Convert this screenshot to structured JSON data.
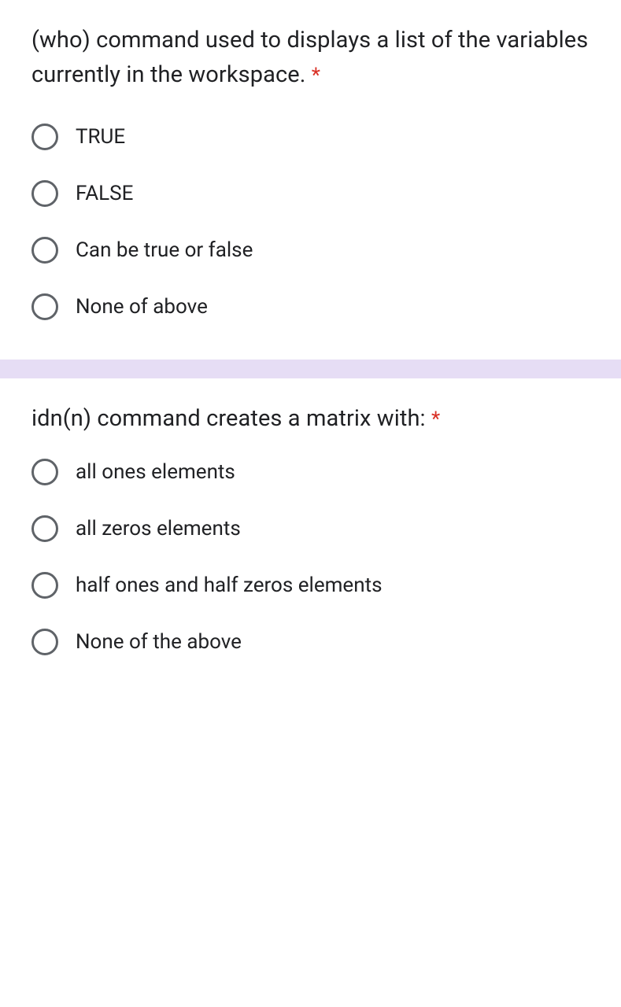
{
  "questions": [
    {
      "text": "(who) command used to displays a list of the variables currently in the workspace.",
      "required": "*",
      "options": [
        {
          "label": "TRUE"
        },
        {
          "label": "FALSE"
        },
        {
          "label": "Can be true or false"
        },
        {
          "label": "None of above"
        }
      ]
    },
    {
      "text": "idn(n) command creates a matrix with:",
      "required": "*",
      "options": [
        {
          "label": "all ones elements"
        },
        {
          "label": "all zeros elements"
        },
        {
          "label": "half ones and half zeros elements"
        },
        {
          "label": "None of the above"
        }
      ]
    }
  ]
}
